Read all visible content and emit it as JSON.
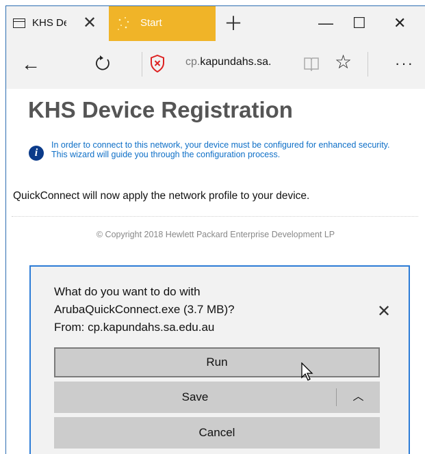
{
  "browser": {
    "tabs": [
      {
        "label": "KHS De"
      },
      {
        "label": "Start"
      }
    ],
    "new_tab_icon": "plus-icon",
    "address": {
      "prefix": "cp.",
      "domain": "kapundahs.sa."
    }
  },
  "page": {
    "title": "KHS Device Registration",
    "info": "In order to connect to this network, your device must be configured for enhanced security. This wizard will guide you through the configuration process.",
    "body": "QuickConnect will now apply the network profile to your device.",
    "copyright": "© Copyright 2018 Hewlett Packard Enterprise Development LP"
  },
  "download_dialog": {
    "line1": "What do you want to do with",
    "line2": "ArubaQuickConnect.exe (3.7 MB)?",
    "line3": "From: cp.kapundahs.sa.edu.au",
    "run": "Run",
    "save": "Save",
    "cancel": "Cancel"
  },
  "colors": {
    "accent": "#2b7bd6",
    "start_tab": "#f0b428",
    "info_text": "#0e6fc7",
    "title": "#555555"
  }
}
